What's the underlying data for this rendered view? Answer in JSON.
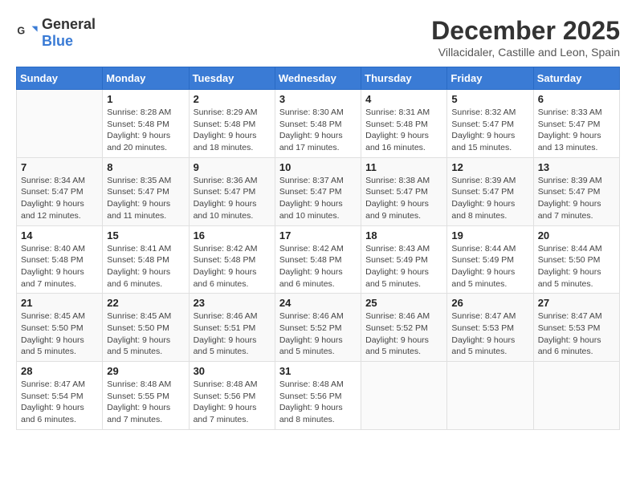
{
  "logo": {
    "text_general": "General",
    "text_blue": "Blue"
  },
  "title": "December 2025",
  "location": "Villacidaler, Castille and Leon, Spain",
  "days_of_week": [
    "Sunday",
    "Monday",
    "Tuesday",
    "Wednesday",
    "Thursday",
    "Friday",
    "Saturday"
  ],
  "weeks": [
    [
      {
        "day": "",
        "sunrise": "",
        "sunset": "",
        "daylight": ""
      },
      {
        "day": "1",
        "sunrise": "Sunrise: 8:28 AM",
        "sunset": "Sunset: 5:48 PM",
        "daylight": "Daylight: 9 hours and 20 minutes."
      },
      {
        "day": "2",
        "sunrise": "Sunrise: 8:29 AM",
        "sunset": "Sunset: 5:48 PM",
        "daylight": "Daylight: 9 hours and 18 minutes."
      },
      {
        "day": "3",
        "sunrise": "Sunrise: 8:30 AM",
        "sunset": "Sunset: 5:48 PM",
        "daylight": "Daylight: 9 hours and 17 minutes."
      },
      {
        "day": "4",
        "sunrise": "Sunrise: 8:31 AM",
        "sunset": "Sunset: 5:48 PM",
        "daylight": "Daylight: 9 hours and 16 minutes."
      },
      {
        "day": "5",
        "sunrise": "Sunrise: 8:32 AM",
        "sunset": "Sunset: 5:47 PM",
        "daylight": "Daylight: 9 hours and 15 minutes."
      },
      {
        "day": "6",
        "sunrise": "Sunrise: 8:33 AM",
        "sunset": "Sunset: 5:47 PM",
        "daylight": "Daylight: 9 hours and 13 minutes."
      }
    ],
    [
      {
        "day": "7",
        "sunrise": "Sunrise: 8:34 AM",
        "sunset": "Sunset: 5:47 PM",
        "daylight": "Daylight: 9 hours and 12 minutes."
      },
      {
        "day": "8",
        "sunrise": "Sunrise: 8:35 AM",
        "sunset": "Sunset: 5:47 PM",
        "daylight": "Daylight: 9 hours and 11 minutes."
      },
      {
        "day": "9",
        "sunrise": "Sunrise: 8:36 AM",
        "sunset": "Sunset: 5:47 PM",
        "daylight": "Daylight: 9 hours and 10 minutes."
      },
      {
        "day": "10",
        "sunrise": "Sunrise: 8:37 AM",
        "sunset": "Sunset: 5:47 PM",
        "daylight": "Daylight: 9 hours and 10 minutes."
      },
      {
        "day": "11",
        "sunrise": "Sunrise: 8:38 AM",
        "sunset": "Sunset: 5:47 PM",
        "daylight": "Daylight: 9 hours and 9 minutes."
      },
      {
        "day": "12",
        "sunrise": "Sunrise: 8:39 AM",
        "sunset": "Sunset: 5:47 PM",
        "daylight": "Daylight: 9 hours and 8 minutes."
      },
      {
        "day": "13",
        "sunrise": "Sunrise: 8:39 AM",
        "sunset": "Sunset: 5:47 PM",
        "daylight": "Daylight: 9 hours and 7 minutes."
      }
    ],
    [
      {
        "day": "14",
        "sunrise": "Sunrise: 8:40 AM",
        "sunset": "Sunset: 5:48 PM",
        "daylight": "Daylight: 9 hours and 7 minutes."
      },
      {
        "day": "15",
        "sunrise": "Sunrise: 8:41 AM",
        "sunset": "Sunset: 5:48 PM",
        "daylight": "Daylight: 9 hours and 6 minutes."
      },
      {
        "day": "16",
        "sunrise": "Sunrise: 8:42 AM",
        "sunset": "Sunset: 5:48 PM",
        "daylight": "Daylight: 9 hours and 6 minutes."
      },
      {
        "day": "17",
        "sunrise": "Sunrise: 8:42 AM",
        "sunset": "Sunset: 5:48 PM",
        "daylight": "Daylight: 9 hours and 6 minutes."
      },
      {
        "day": "18",
        "sunrise": "Sunrise: 8:43 AM",
        "sunset": "Sunset: 5:49 PM",
        "daylight": "Daylight: 9 hours and 5 minutes."
      },
      {
        "day": "19",
        "sunrise": "Sunrise: 8:44 AM",
        "sunset": "Sunset: 5:49 PM",
        "daylight": "Daylight: 9 hours and 5 minutes."
      },
      {
        "day": "20",
        "sunrise": "Sunrise: 8:44 AM",
        "sunset": "Sunset: 5:50 PM",
        "daylight": "Daylight: 9 hours and 5 minutes."
      }
    ],
    [
      {
        "day": "21",
        "sunrise": "Sunrise: 8:45 AM",
        "sunset": "Sunset: 5:50 PM",
        "daylight": "Daylight: 9 hours and 5 minutes."
      },
      {
        "day": "22",
        "sunrise": "Sunrise: 8:45 AM",
        "sunset": "Sunset: 5:50 PM",
        "daylight": "Daylight: 9 hours and 5 minutes."
      },
      {
        "day": "23",
        "sunrise": "Sunrise: 8:46 AM",
        "sunset": "Sunset: 5:51 PM",
        "daylight": "Daylight: 9 hours and 5 minutes."
      },
      {
        "day": "24",
        "sunrise": "Sunrise: 8:46 AM",
        "sunset": "Sunset: 5:52 PM",
        "daylight": "Daylight: 9 hours and 5 minutes."
      },
      {
        "day": "25",
        "sunrise": "Sunrise: 8:46 AM",
        "sunset": "Sunset: 5:52 PM",
        "daylight": "Daylight: 9 hours and 5 minutes."
      },
      {
        "day": "26",
        "sunrise": "Sunrise: 8:47 AM",
        "sunset": "Sunset: 5:53 PM",
        "daylight": "Daylight: 9 hours and 5 minutes."
      },
      {
        "day": "27",
        "sunrise": "Sunrise: 8:47 AM",
        "sunset": "Sunset: 5:53 PM",
        "daylight": "Daylight: 9 hours and 6 minutes."
      }
    ],
    [
      {
        "day": "28",
        "sunrise": "Sunrise: 8:47 AM",
        "sunset": "Sunset: 5:54 PM",
        "daylight": "Daylight: 9 hours and 6 minutes."
      },
      {
        "day": "29",
        "sunrise": "Sunrise: 8:48 AM",
        "sunset": "Sunset: 5:55 PM",
        "daylight": "Daylight: 9 hours and 7 minutes."
      },
      {
        "day": "30",
        "sunrise": "Sunrise: 8:48 AM",
        "sunset": "Sunset: 5:56 PM",
        "daylight": "Daylight: 9 hours and 7 minutes."
      },
      {
        "day": "31",
        "sunrise": "Sunrise: 8:48 AM",
        "sunset": "Sunset: 5:56 PM",
        "daylight": "Daylight: 9 hours and 8 minutes."
      },
      {
        "day": "",
        "sunrise": "",
        "sunset": "",
        "daylight": ""
      },
      {
        "day": "",
        "sunrise": "",
        "sunset": "",
        "daylight": ""
      },
      {
        "day": "",
        "sunrise": "",
        "sunset": "",
        "daylight": ""
      }
    ]
  ]
}
